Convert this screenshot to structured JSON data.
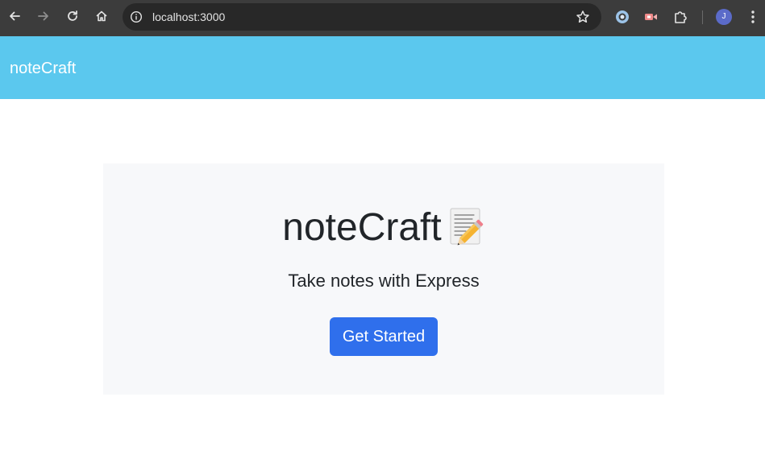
{
  "browser": {
    "url": "localhost:3000",
    "profile_initial": "J",
    "icons": {
      "back": "arrow-left-icon",
      "forward": "arrow-right-icon",
      "reload": "reload-icon",
      "home": "home-icon",
      "site_info": "info-icon",
      "bookmark": "star-icon",
      "extensions": "puzzle-icon",
      "menu": "three-dots-icon"
    }
  },
  "navbar": {
    "brand": "noteCraft",
    "color": "#5bc8ee"
  },
  "hero": {
    "title": "noteCraft",
    "title_emoji": "memo-pencil-icon",
    "subtitle": "Take notes with Express",
    "cta_label": "Get Started",
    "background": "#f7f8fa",
    "cta_color": "#2f6fec"
  }
}
